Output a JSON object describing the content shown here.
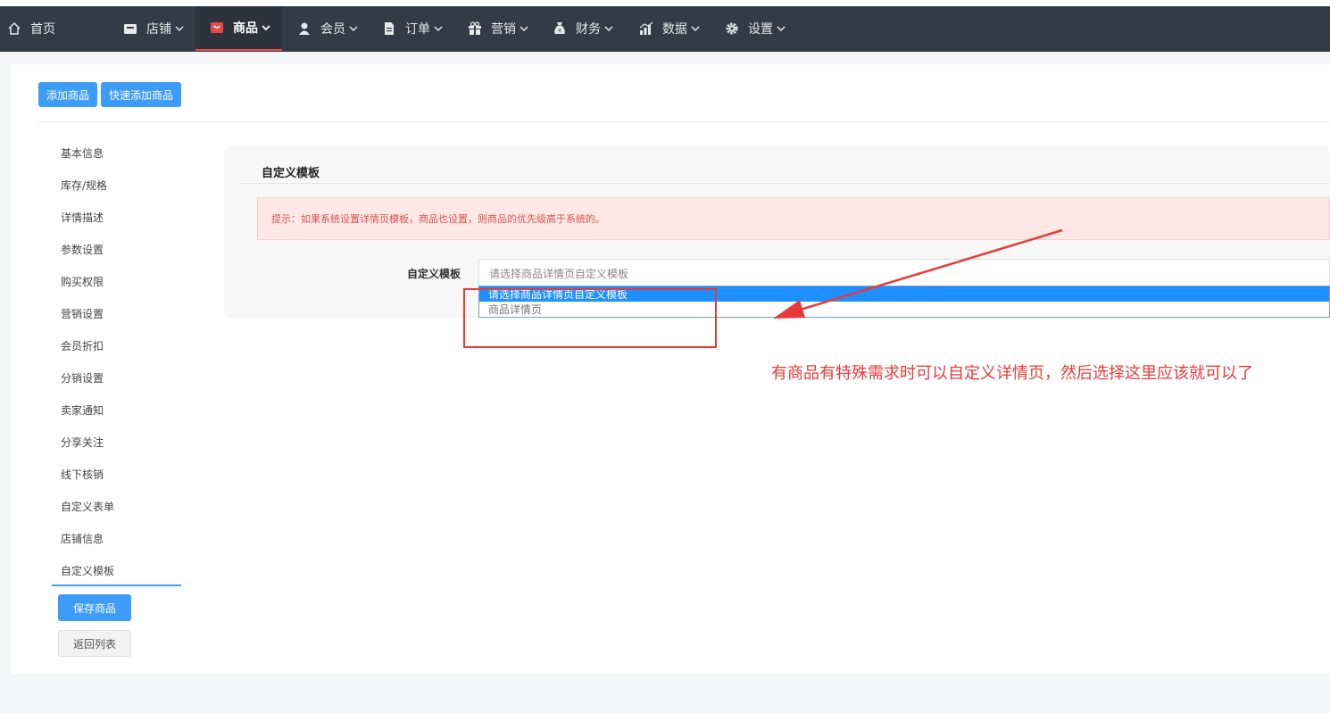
{
  "nav": {
    "items": [
      {
        "label": "首页",
        "icon": "home-icon",
        "chevron": false,
        "active": false
      },
      {
        "label": "店铺",
        "icon": "store-icon",
        "chevron": true,
        "active": false
      },
      {
        "label": "商品",
        "icon": "bag-icon",
        "chevron": true,
        "active": true
      },
      {
        "label": "会员",
        "icon": "user-icon",
        "chevron": true,
        "active": false
      },
      {
        "label": "订单",
        "icon": "document-icon",
        "chevron": true,
        "active": false
      },
      {
        "label": "营销",
        "icon": "gift-icon",
        "chevron": true,
        "active": false
      },
      {
        "label": "财务",
        "icon": "moneybag-icon",
        "chevron": true,
        "active": false
      },
      {
        "label": "数据",
        "icon": "chart-icon",
        "chevron": true,
        "active": false
      },
      {
        "label": "设置",
        "icon": "gear-icon",
        "chevron": true,
        "active": false
      }
    ]
  },
  "toolbar": {
    "add_label": "添加商品",
    "quick_add_label": "快速添加商品"
  },
  "sidebar": {
    "items": [
      "基本信息",
      "库存/规格",
      "详情描述",
      "参数设置",
      "购买权限",
      "营销设置",
      "会员折扣",
      "分销设置",
      "卖家通知",
      "分享关注",
      "线下核销",
      "自定义表单",
      "店铺信息",
      "自定义模板"
    ],
    "active": "自定义模板",
    "save_label": "保存商品",
    "back_label": "返回列表"
  },
  "panel": {
    "title": "自定义模板",
    "alert": "提示：如果系统设置详情页模板，商品也设置，则商品的优先级高于系统的。",
    "field_label": "自定义模板",
    "select_value": "请选择商品详情页自定义模板",
    "options": [
      "请选择商品详情页自定义模板",
      "商品详情页"
    ]
  },
  "annotation": {
    "text": "有商品有特殊需求时可以自定义详情页，然后选择这里应该就可以了",
    "color": "#e83a3a"
  },
  "colors": {
    "topbar": "#353b46",
    "accent": "#3d9cf7",
    "active_underline": "#e84a4a"
  }
}
